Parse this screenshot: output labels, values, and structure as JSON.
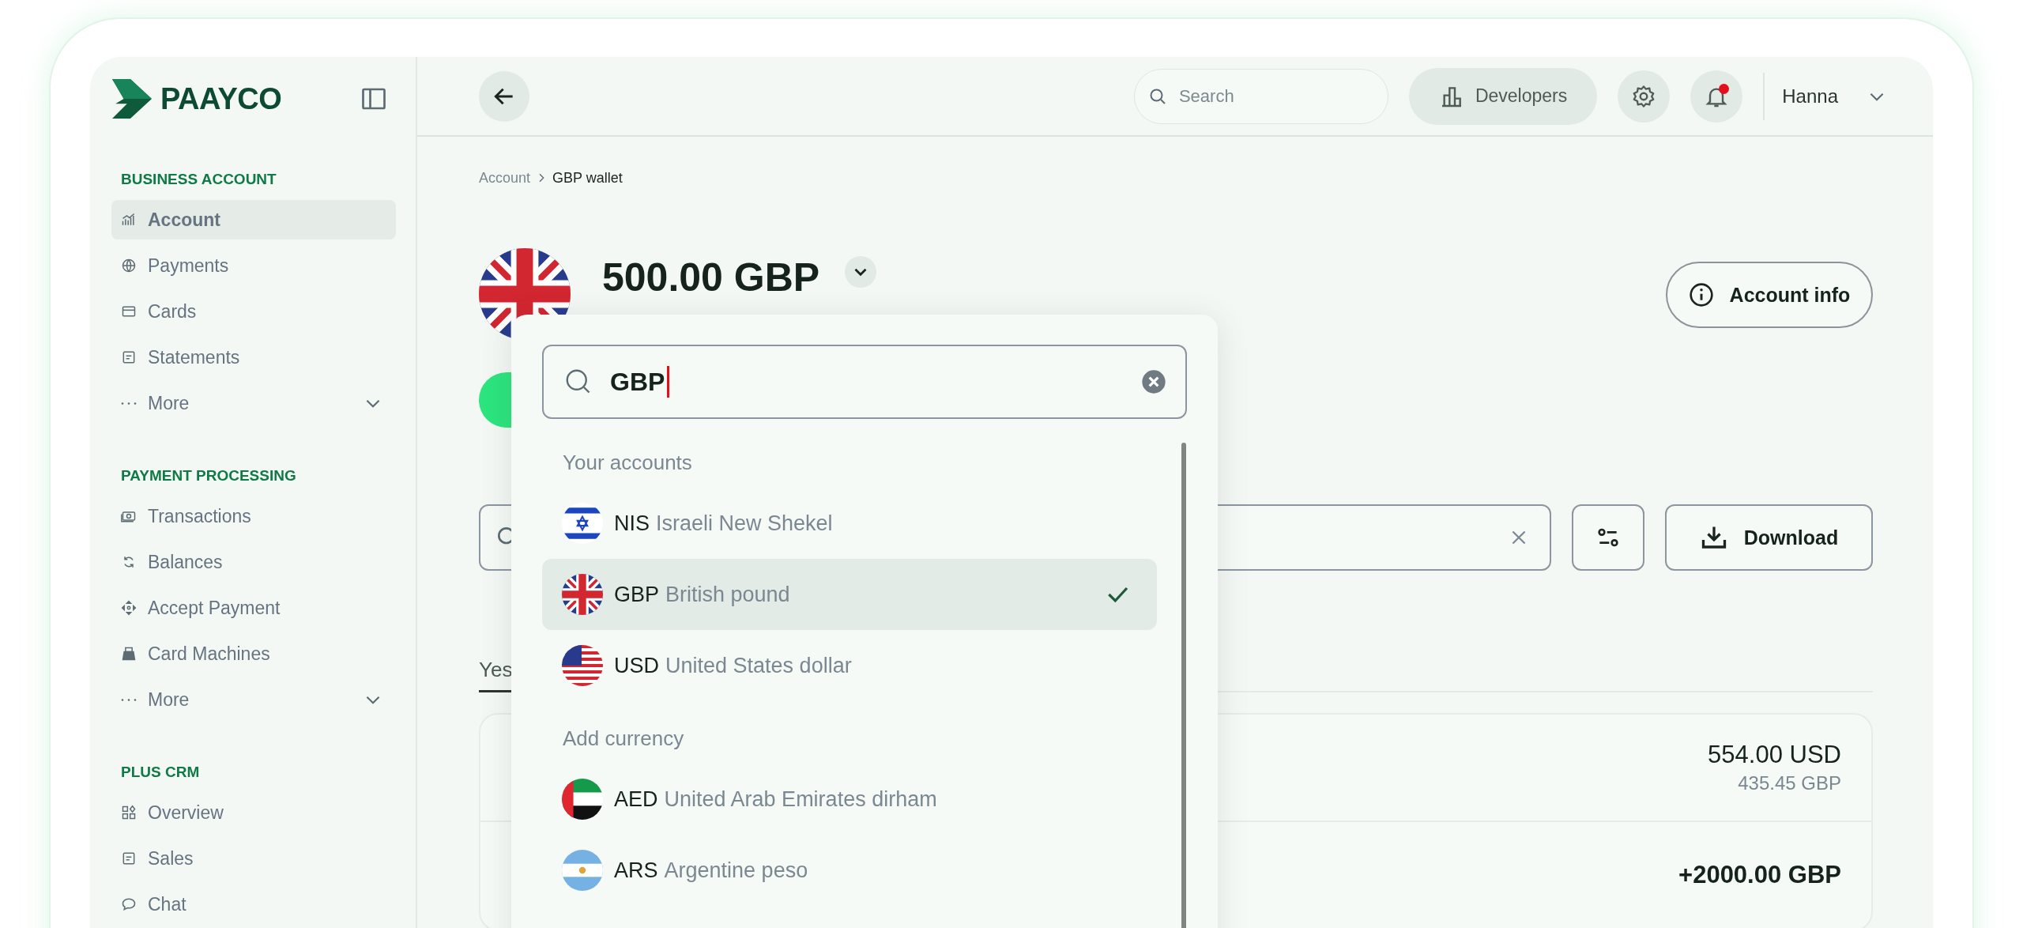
{
  "sidebar": {
    "logo": "PAAYCO",
    "sections": [
      {
        "title": "BUSINESS ACCOUNT",
        "items": [
          {
            "label": "Account",
            "kind": "link",
            "selected": true
          },
          {
            "label": "Payments",
            "kind": "link",
            "selected": false
          },
          {
            "label": "Cards",
            "kind": "link",
            "selected": false
          },
          {
            "label": "Statements",
            "kind": "link",
            "selected": false
          },
          {
            "label": "More",
            "kind": "more",
            "expanded": false
          }
        ]
      },
      {
        "title": "PAYMENT PROCESSING",
        "items": [
          {
            "label": "Transactions",
            "kind": "link",
            "selected": false
          },
          {
            "label": "Balances",
            "kind": "link",
            "selected": false
          },
          {
            "label": "Accept Payment",
            "kind": "link",
            "selected": false
          },
          {
            "label": "Card Machines",
            "kind": "link",
            "selected": false
          },
          {
            "label": "More",
            "kind": "more",
            "expanded": false
          }
        ]
      },
      {
        "title": "PLUS CRM",
        "items": [
          {
            "label": "Overview",
            "kind": "link",
            "selected": false
          },
          {
            "label": "Sales",
            "kind": "link",
            "selected": false
          },
          {
            "label": "Chat",
            "kind": "link",
            "selected": false
          }
        ]
      }
    ]
  },
  "header": {
    "search": {
      "placeholder": "Search"
    },
    "developers": "Developers",
    "notification": true,
    "user": "Hanna"
  },
  "breadcrumb": [
    "Account",
    "GBP wallet"
  ],
  "wallet": {
    "kind": "gb",
    "balance": "500.00 GBP",
    "account_info": "Account info"
  },
  "toolbar": {
    "download": "Download"
  },
  "tabs": [
    {
      "label": "Yes",
      "selected": true
    }
  ],
  "transactions": [
    {
      "kind": "conversion",
      "amount": "554.00 USD",
      "converted": "435.45 GBP"
    },
    {
      "kind": "credit",
      "amount": "+2000.00 GBP"
    }
  ],
  "currency_dropdown": {
    "search": {
      "value": "GBP"
    },
    "groups": [
      {
        "title": "Your accounts",
        "items": [
          {
            "kind": "il",
            "code": "NIS",
            "name": "Israeli New Shekel",
            "selected": false
          },
          {
            "kind": "gb",
            "code": "GBP",
            "name": "British pound",
            "selected": true
          },
          {
            "kind": "us",
            "code": "USD",
            "name": "United States dollar",
            "selected": false
          }
        ]
      },
      {
        "title": "Add currency",
        "items": [
          {
            "kind": "ae",
            "code": "AED",
            "name": "United Arab Emirates dirham",
            "selected": false
          },
          {
            "kind": "ar",
            "code": "ARS",
            "name": "Argentine peso",
            "selected": false
          }
        ]
      }
    ]
  }
}
